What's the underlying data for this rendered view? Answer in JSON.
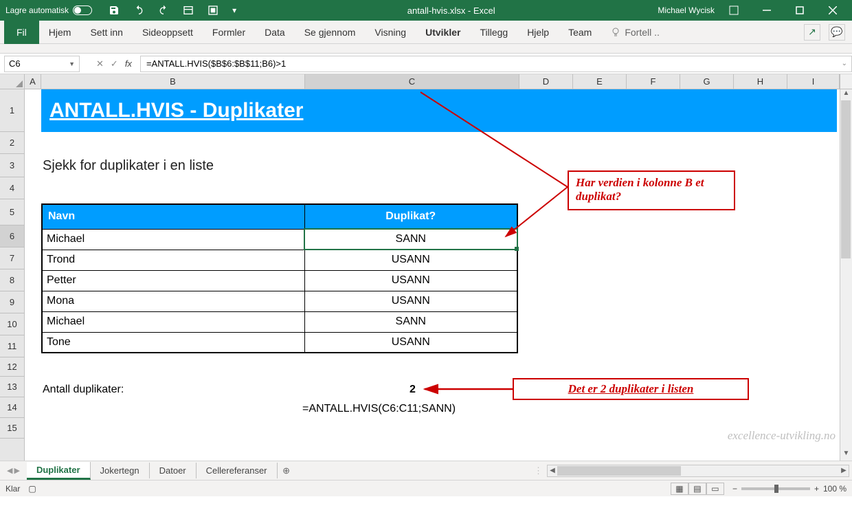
{
  "titlebar": {
    "autosave_label": "Lagre automatisk",
    "document_title": "antall-hvis.xlsx  -  Excel",
    "user_name": "Michael Wycisk"
  },
  "ribbon": {
    "tabs": [
      "Fil",
      "Hjem",
      "Sett inn",
      "Sideoppsett",
      "Formler",
      "Data",
      "Se gjennom",
      "Visning",
      "Utvikler",
      "Tillegg",
      "Hjelp",
      "Team"
    ],
    "active_tab": "Utvikler",
    "tell_me": "Fortell .."
  },
  "formula_bar": {
    "cell_ref": "C6",
    "formula": "=ANTALL.HVIS($B$6:$B$11;B6)>1"
  },
  "columns": [
    "A",
    "B",
    "C",
    "D",
    "E",
    "F",
    "G",
    "H",
    "I"
  ],
  "rows": [
    "1",
    "2",
    "3",
    "4",
    "5",
    "6",
    "7",
    "8",
    "9",
    "10",
    "11",
    "12",
    "13",
    "14",
    "15"
  ],
  "sheet": {
    "title": "ANTALL.HVIS - Duplikater",
    "subtitle": "Sjekk for duplikater i en liste",
    "table": {
      "headers": {
        "name": "Navn",
        "dup": "Duplikat?"
      },
      "rows": [
        {
          "name": "Michael",
          "dup": "SANN"
        },
        {
          "name": "Trond",
          "dup": "USANN"
        },
        {
          "name": "Petter",
          "dup": "USANN"
        },
        {
          "name": "Mona",
          "dup": "USANN"
        },
        {
          "name": "Michael",
          "dup": "SANN"
        },
        {
          "name": "Tone",
          "dup": "USANN"
        }
      ]
    },
    "count_label": "Antall duplikater:",
    "count_value": "2",
    "count_formula": "=ANTALL.HVIS(C6:C11;SANN)",
    "callout1": "Har verdien i kolonne B et duplikat?",
    "callout2": "Det er 2 duplikater i listen",
    "watermark": "excellence-utvikling.no"
  },
  "sheet_tabs": {
    "tabs": [
      "Duplikater",
      "Jokertegn",
      "Datoer",
      "Cellereferanser"
    ],
    "active": "Duplikater"
  },
  "statusbar": {
    "ready": "Klar",
    "zoom": "100 %"
  }
}
